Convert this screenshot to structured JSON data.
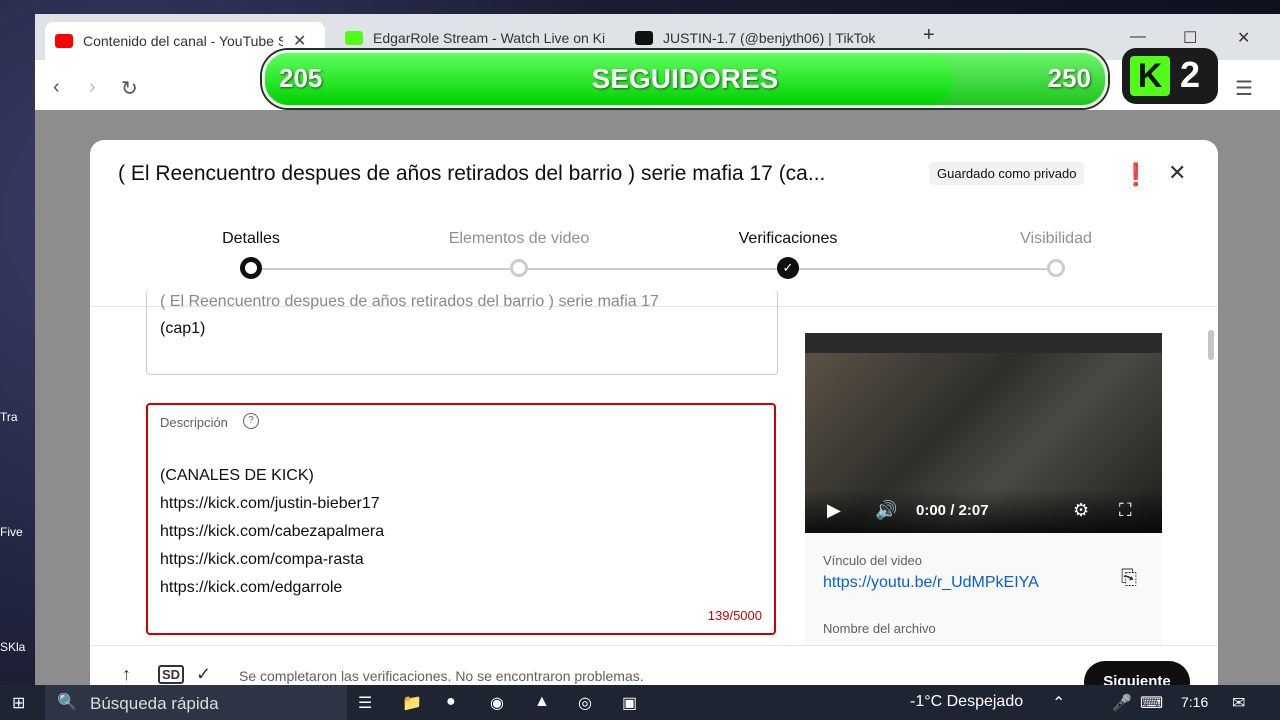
{
  "browser": {
    "tabs": [
      {
        "label": "Contenido del canal - YouTube S",
        "icon": "youtube-icon",
        "active": true
      },
      {
        "label": "EdgarRole Stream - Watch Live on Ki",
        "icon": "kick-icon",
        "active": false
      },
      {
        "label": "JUSTIN-1.7 (@benjyth06) | TikTok",
        "icon": "tiktok-icon",
        "active": false
      }
    ],
    "new_tab": "+",
    "close_glyph": "✕"
  },
  "overlay": {
    "start": "205",
    "label": "SEGUIDORES",
    "goal": "250",
    "progress_fraction": 0.82,
    "kick_logo": "K",
    "kick_count": "2"
  },
  "dialog": {
    "title": "( El Reencuentro despues de años retirados del barrio ) serie mafia 17 (ca...",
    "saved_badge": "Guardado como privado",
    "steps": [
      "Detalles",
      "Elementos de video",
      "Verificaciones",
      "Visibilidad"
    ],
    "title_field_partial": "( El Reencuentro despues de años retirados del barrio ) serie mafia 17",
    "title_field_value": "(cap1)",
    "description_label": "Descripción",
    "description_lines": [
      "(CANALES DE KICK)",
      "https://kick.com/justin-bieber17",
      "https://kick.com/cabezapalmera",
      "https://kick.com/compa-rasta",
      "https://kick.com/edgarrole"
    ],
    "char_count": "139/5000",
    "video_time": "0:00 / 2:07",
    "video_link_label": "Vínculo del video",
    "video_link": "https://youtu.be/r_UdMPkEIYA",
    "filename_label": "Nombre del archivo",
    "footer_msg": "Se completaron las verificaciones. No se encontraron problemas.",
    "next_button": "Siguiente",
    "sd_badge": "SD"
  },
  "taskbar": {
    "search_placeholder": "Búsqueda rápida",
    "weather": "-1°C  Despejado",
    "time": "7:16"
  },
  "colors": {
    "accent_red": "#cc0000",
    "kick_green": "#53fc18",
    "link_blue": "#065fd4"
  }
}
